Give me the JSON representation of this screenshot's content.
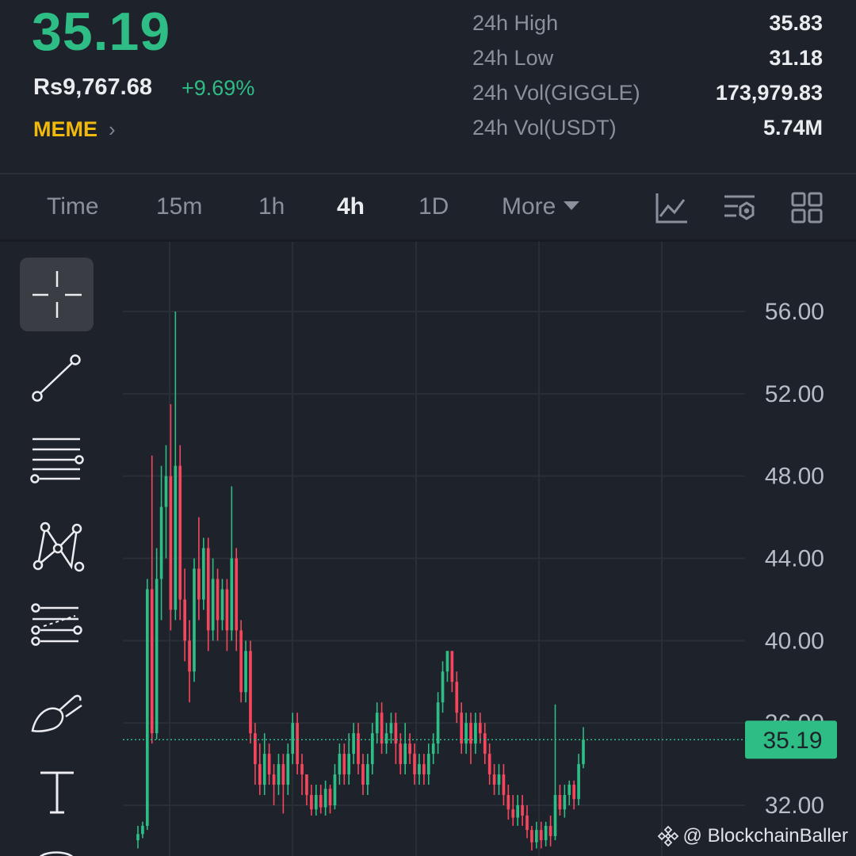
{
  "ticker": {
    "last_price": "35.19",
    "fiat_price": "Rs9,767.68",
    "change_pct": "+9.69%",
    "tag": "MEME",
    "stats": [
      {
        "label": "24h High",
        "value": "35.83"
      },
      {
        "label": "24h Low",
        "value": "31.18"
      },
      {
        "label": "24h Vol(GIGGLE)",
        "value": "173,979.83"
      },
      {
        "label": "24h Vol(USDT)",
        "value": "5.74M"
      }
    ]
  },
  "intervals": {
    "time": "Time",
    "m15": "15m",
    "h1": "1h",
    "h4": "4h",
    "d1": "1D",
    "more": "More",
    "active": "4h"
  },
  "icons": {
    "indicator": "line-chart-icon",
    "settings": "chart-settings-icon",
    "layout": "grid-layout-icon"
  },
  "side_tools": [
    "crosshair-icon",
    "trend-line-icon",
    "horizontal-lines-icon",
    "pattern-icon",
    "fib-channel-icon",
    "brush-icon",
    "text-icon"
  ],
  "colors": {
    "up": "#2ebd85",
    "down": "#f6465d",
    "accent": "#f0b90b",
    "bg": "#1e222b"
  },
  "chart_data": {
    "type": "candlestick",
    "y_ticks": [
      "56.00",
      "52.00",
      "48.00",
      "44.00",
      "40.00",
      "36.00",
      "32.00"
    ],
    "ylim": [
      30.5,
      58.5
    ],
    "last_price_label": "35.19",
    "last_price": 35.19,
    "candles": [
      [
        30.3,
        30.6,
        29.9,
        31.0
      ],
      [
        30.6,
        31.0,
        30.4,
        31.2
      ],
      [
        31.0,
        42.5,
        30.8,
        43.0
      ],
      [
        42.5,
        35.5,
        35.0,
        49.0
      ],
      [
        35.5,
        43.0,
        35.2,
        44.5
      ],
      [
        43.0,
        46.5,
        41.0,
        48.5
      ],
      [
        46.5,
        48.0,
        44.0,
        49.5
      ],
      [
        48.0,
        41.5,
        40.5,
        51.5
      ],
      [
        41.5,
        48.5,
        41.0,
        56.0
      ],
      [
        48.5,
        42.0,
        41.0,
        49.5
      ],
      [
        42.0,
        40.0,
        39.0,
        43.5
      ],
      [
        40.0,
        38.5,
        37.0,
        41.0
      ],
      [
        38.5,
        43.5,
        38.0,
        44.0
      ],
      [
        43.5,
        42.0,
        41.0,
        46.0
      ],
      [
        42.0,
        44.5,
        41.5,
        45.0
      ],
      [
        44.5,
        40.5,
        39.5,
        45.0
      ],
      [
        40.5,
        43.0,
        40.0,
        44.0
      ],
      [
        43.0,
        41.0,
        40.0,
        43.5
      ],
      [
        41.0,
        42.5,
        40.5,
        43.0
      ],
      [
        42.5,
        40.5,
        39.5,
        43.0
      ],
      [
        40.5,
        44.0,
        40.0,
        47.5
      ],
      [
        44.0,
        40.5,
        39.5,
        44.5
      ],
      [
        40.5,
        37.5,
        37.0,
        41.0
      ],
      [
        37.5,
        39.5,
        37.0,
        40.0
      ],
      [
        39.5,
        35.5,
        35.0,
        40.0
      ],
      [
        35.5,
        34.0,
        33.0,
        36.0
      ],
      [
        34.0,
        33.0,
        32.5,
        35.0
      ],
      [
        33.0,
        34.5,
        32.5,
        35.5
      ],
      [
        34.5,
        33.5,
        33.0,
        35.0
      ],
      [
        33.5,
        33.0,
        32.0,
        34.0
      ],
      [
        33.0,
        34.0,
        32.5,
        34.5
      ],
      [
        34.0,
        33.0,
        31.6,
        34.5
      ],
      [
        33.0,
        34.5,
        32.5,
        35.0
      ],
      [
        34.5,
        36.0,
        34.0,
        36.5
      ],
      [
        36.0,
        34.0,
        33.5,
        36.5
      ],
      [
        34.0,
        33.5,
        32.5,
        34.5
      ],
      [
        33.5,
        32.5,
        32.0,
        33.5
      ],
      [
        32.5,
        31.8,
        31.5,
        33.0
      ],
      [
        31.8,
        32.5,
        31.5,
        33.0
      ],
      [
        32.5,
        31.9,
        31.6,
        33.0
      ],
      [
        31.9,
        32.8,
        31.5,
        33.2
      ],
      [
        32.8,
        32.0,
        31.6,
        33.0
      ],
      [
        32.0,
        33.5,
        31.8,
        34.0
      ],
      [
        33.5,
        34.5,
        33.0,
        35.0
      ],
      [
        34.5,
        33.5,
        33.0,
        35.0
      ],
      [
        33.5,
        34.5,
        33.0,
        35.5
      ],
      [
        34.5,
        35.5,
        34.0,
        36.0
      ],
      [
        35.5,
        34.0,
        33.5,
        36.0
      ],
      [
        34.0,
        33.0,
        32.5,
        34.5
      ],
      [
        33.0,
        34.0,
        32.5,
        34.5
      ],
      [
        34.0,
        35.5,
        33.5,
        36.0
      ],
      [
        35.5,
        36.5,
        35.0,
        37.0
      ],
      [
        36.5,
        35.0,
        34.5,
        37.0
      ],
      [
        35.0,
        35.5,
        34.5,
        36.0
      ],
      [
        35.5,
        36.0,
        35.0,
        36.5
      ],
      [
        36.0,
        35.0,
        34.0,
        36.5
      ],
      [
        35.0,
        34.0,
        33.5,
        35.5
      ],
      [
        34.0,
        35.0,
        33.5,
        36.0
      ],
      [
        35.0,
        34.5,
        34.0,
        35.5
      ],
      [
        34.5,
        33.5,
        33.0,
        35.0
      ],
      [
        33.5,
        34.0,
        33.0,
        34.5
      ],
      [
        34.0,
        33.5,
        33.0,
        34.5
      ],
      [
        33.5,
        34.5,
        33.0,
        35.0
      ],
      [
        34.5,
        35.0,
        34.0,
        35.5
      ],
      [
        35.0,
        37.0,
        34.5,
        37.5
      ],
      [
        37.0,
        38.5,
        36.5,
        39.0
      ],
      [
        38.5,
        39.5,
        38.0,
        39.5
      ],
      [
        39.5,
        38.0,
        37.5,
        39.5
      ],
      [
        38.0,
        36.5,
        36.0,
        38.5
      ],
      [
        36.5,
        35.0,
        34.5,
        37.0
      ],
      [
        35.0,
        36.0,
        34.5,
        36.5
      ],
      [
        36.0,
        35.0,
        34.0,
        36.5
      ],
      [
        35.0,
        36.0,
        34.5,
        36.5
      ],
      [
        36.0,
        35.5,
        35.0,
        36.5
      ],
      [
        35.5,
        34.5,
        34.0,
        36.0
      ],
      [
        34.5,
        33.5,
        33.0,
        35.0
      ],
      [
        33.5,
        33.0,
        32.5,
        34.0
      ],
      [
        33.0,
        33.5,
        32.5,
        34.0
      ],
      [
        33.5,
        32.5,
        32.0,
        34.0
      ],
      [
        32.5,
        31.8,
        31.3,
        33.0
      ],
      [
        31.8,
        31.4,
        31.0,
        32.5
      ],
      [
        31.4,
        32.0,
        31.0,
        32.5
      ],
      [
        32.0,
        31.5,
        31.0,
        32.5
      ],
      [
        31.5,
        30.8,
        30.4,
        32.0
      ],
      [
        30.8,
        30.2,
        29.8,
        31.0
      ],
      [
        30.2,
        30.8,
        29.9,
        31.2
      ],
      [
        30.8,
        30.3,
        29.9,
        31.2
      ],
      [
        30.3,
        31.0,
        30.0,
        31.2
      ],
      [
        31.0,
        30.5,
        30.0,
        31.5
      ],
      [
        30.5,
        32.5,
        30.3,
        36.9
      ],
      [
        32.5,
        31.8,
        31.5,
        33.0
      ],
      [
        31.8,
        32.5,
        31.4,
        33.0
      ],
      [
        32.5,
        33.0,
        32.0,
        33.2
      ],
      [
        33.0,
        32.3,
        31.8,
        33.2
      ],
      [
        32.3,
        34.0,
        32.0,
        34.5
      ],
      [
        34.0,
        35.19,
        33.8,
        35.8
      ]
    ]
  },
  "watermark": "@ BlockchainBaller"
}
